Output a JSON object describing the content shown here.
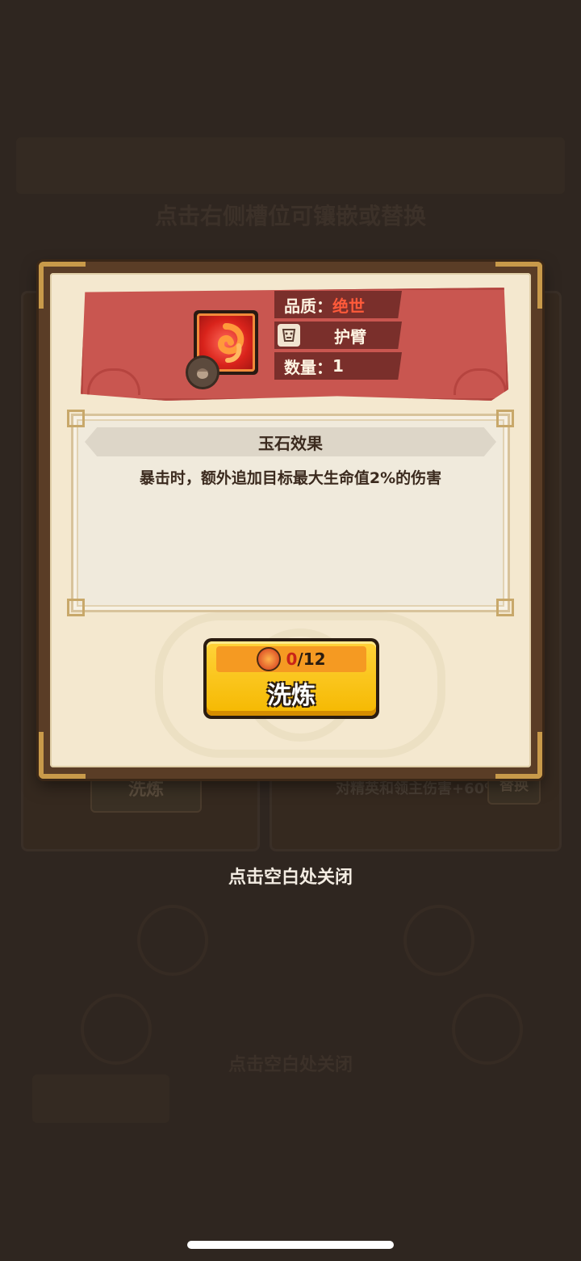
{
  "background": {
    "hint_top": "点击右侧槽位可镶嵌或替换",
    "refine_label": "洗炼",
    "effect_text": "对精英和领主伤害+60%",
    "replace_label": "替换",
    "hint_bottom": "点击空白处关闭"
  },
  "modal": {
    "quality_label": "品质：",
    "quality_value": "绝世",
    "slot_name": "护臂",
    "quantity_label": "数量：",
    "quantity_value": "1",
    "effect_title": "玉石效果",
    "effect_description": "暴击时，额外追加目标最大生命值2%的伤害",
    "refine_button": {
      "cost_have": "0",
      "cost_need": "/12",
      "label": "洗炼"
    }
  },
  "close_hint": "点击空白处关闭",
  "icons": {
    "gem": "red-swirl-gem-icon",
    "gem_badge": "acorn-icon",
    "slot": "armguard-icon",
    "cost": "flame-stone-icon"
  },
  "colors": {
    "banner": "#c95650",
    "rarity": "#ff5a3a",
    "button": "#f5b800",
    "cost_have": "#c82418"
  }
}
